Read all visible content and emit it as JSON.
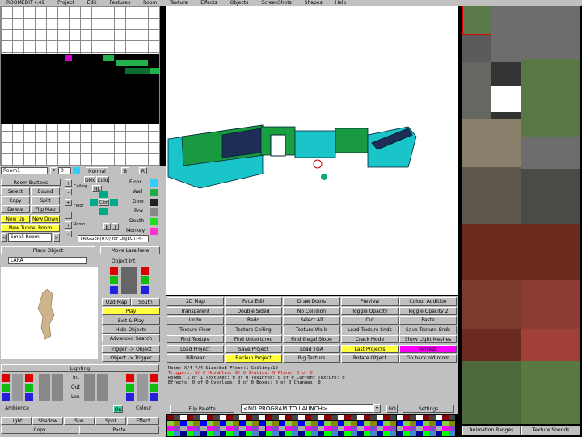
{
  "menu": [
    "ROOMEDIT v.49",
    "Project",
    "Edit",
    "Features",
    "Room",
    "Texture",
    "Effects",
    "Objects",
    "ScreenShots",
    "Shapes",
    "Help"
  ],
  "room": {
    "name": "Room1",
    "field_f": "0",
    "normal_label": "Normal",
    "flip_label": "8",
    "box_label": "R"
  },
  "room_buttons": {
    "title": "Room Buttons",
    "select": "Select",
    "bound": "Bound",
    "copy": "Copy",
    "split": "Split",
    "delete": "Delete",
    "flip_map": "Flip Map",
    "new_up": "New Up",
    "new_down": "New Down",
    "new_tunnel": "New Tunnel Room",
    "small_room": "Small Room",
    "prev": "<",
    "next": ">"
  },
  "mid_labels": {
    "ceiling": "Ceiling",
    "dmg": "DMG",
    "cold": "Cold",
    "hl": "HL",
    "floor": "Floor",
    "room": "Room",
    "climb": "Climb",
    "b": "B",
    "t": "T"
  },
  "right_labels": {
    "floor": "Floor",
    "wall": "Wall",
    "door": "Door",
    "box": "Box",
    "death": "Death",
    "monkey": "Monkey"
  },
  "trigger_text": "TRIGGER(0:0) for OBJECT(<-",
  "place_object": "Place Object",
  "move_lara": "Move Lara here",
  "object_name": "LARA",
  "object_int": "Object Int",
  "object_buttons": {
    "u2d_map": "U2d Map",
    "south": "South",
    "play": "Play",
    "exit_play": "Exit & Play",
    "hide_objects": "Hide Objects",
    "advanced_search": "Advanced Search",
    "trigger_object": "Trigger -> Object",
    "object_trigger": "Object -> Trigger"
  },
  "lighting": {
    "title": "Lighting",
    "int": "Int",
    "out": "Out",
    "len": "Len",
    "ambience": "Ambience",
    "colour": "Colour",
    "on": "On",
    "light": "Light",
    "shadow": "Shadow",
    "sun": "Sun",
    "spot": "Spot",
    "effect": "Effect",
    "copy": "Copy",
    "paste": "Paste"
  },
  "tool_buttons": [
    [
      "2D Map",
      "Face Edit",
      "Draw Doors",
      "Preview",
      "Colour Addition"
    ],
    [
      "Transparent",
      "Double Sided",
      "No Collision",
      "Toggle Opacity",
      "Toggle Opacity 2"
    ],
    [
      "Undo",
      "Redo",
      "Select All",
      "Cut",
      "Paste"
    ],
    [
      "Texture Floor",
      "Texture Ceiling",
      "Texture Walls",
      "Load Texture Snds",
      "Save Texture Snds"
    ],
    [
      "Find Texture",
      "Find Untextured",
      "Find Illegal Slope",
      "Crack Mode",
      "Show Light Meshes"
    ],
    [
      "Load Project",
      "Save Project",
      "Load TGA",
      "Last Projects",
      "Refresh"
    ],
    [
      "Bilinear",
      "Backup Project",
      "Big Texture",
      "Rotate Object",
      "Go back old room"
    ]
  ],
  "status": {
    "line1": "Room: X/4 Y/4      Size:8x8      Floor:1 Ceiling:19",
    "line2": "Triggers: 0/ 0  Movables: 0/ 0  Statics: 0",
    "line2b": "Plane: 0 of 0",
    "line3": "Rooms: 1 of 1    Textures: 0 of 0    TexInfos: 0 of 0   Current Texture: 0",
    "line4": "Effects: 0 of 0  Overlaps: 0 of 0   Boxes: 0 of 0      Changes: 0"
  },
  "flip_palette": "Flip Palette",
  "launch": "<NO PROGRAM TO LAUNCH>",
  "go": "GO",
  "settings": "Settings",
  "tex_tabs": {
    "animation": "Animation Ranges",
    "sounds": "Texture Sounds"
  }
}
